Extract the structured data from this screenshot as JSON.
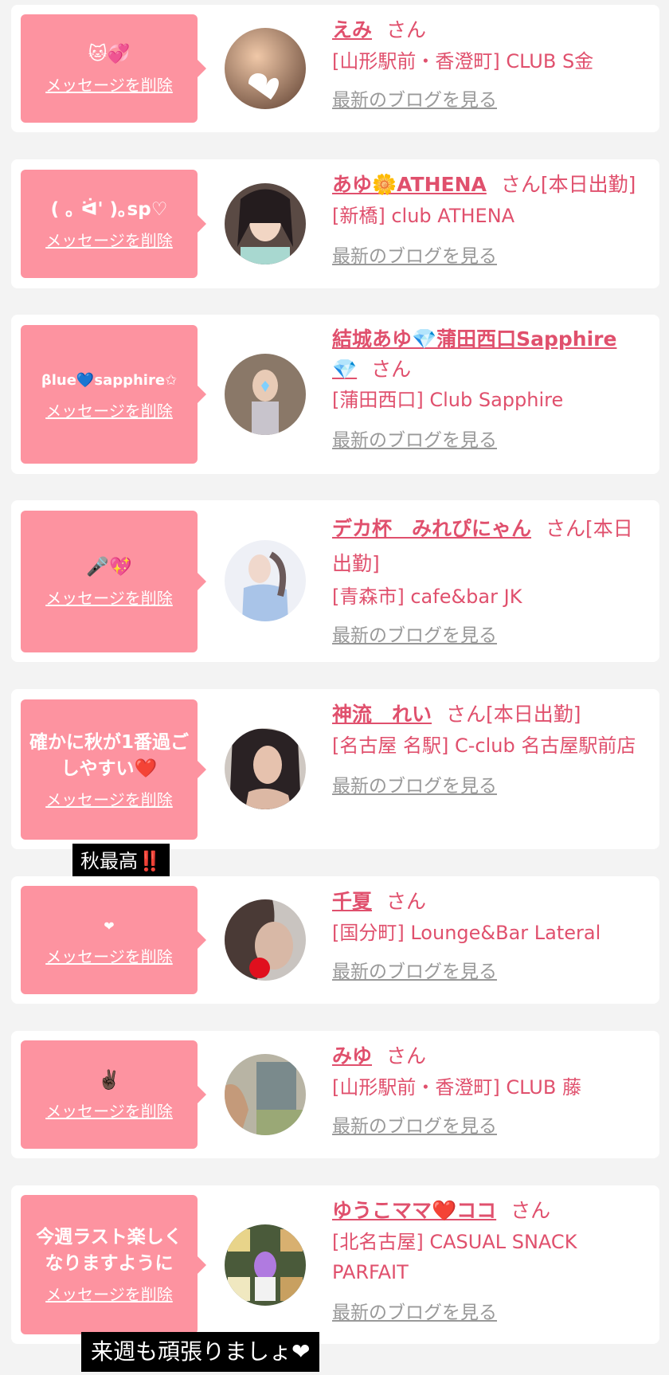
{
  "delete_label": "メッセージを削除",
  "honorific": "さん",
  "blog_label": "最新のブログを見る",
  "colors": {
    "accent": "#e0506d",
    "bubble": "#fd93a0",
    "link_gray": "#999999"
  },
  "messages": [
    {
      "bubble_text": "🐱💞",
      "name": "えみ",
      "suffix": "",
      "shop": "[山形駅前・香澄町] CLUB S金"
    },
    {
      "bubble_text": "( ｡ ᐛ' )｡sp♡",
      "name": "あゆ🌼ATHENA",
      "suffix": "[本日出勤]",
      "shop": "[新橋] club ATHENA"
    },
    {
      "bubble_text": "βlue💙sapphire✩",
      "name": "結城あゆ💎蒲田西口Sapphire 💎",
      "suffix": "",
      "shop": "[蒲田西口] Club Sapphire"
    },
    {
      "bubble_text": "🎤💖",
      "name": "デカ杯　みれぴにゃん",
      "suffix": "[本日出勤]",
      "shop": "[青森市] cafe&bar JK"
    },
    {
      "bubble_text": "確かに秋が1番過ごしやすい❤️",
      "name": "神流　れい",
      "suffix": "[本日出勤]",
      "shop": "[名古屋 名駅] C-club 名古屋駅前店"
    },
    {
      "bubble_text": "❤",
      "name": "千夏",
      "suffix": "",
      "shop": "[国分町] Lounge&Bar Lateral"
    },
    {
      "bubble_text": "✌🏿",
      "name": "みゆ",
      "suffix": "",
      "shop": "[山形駅前・香澄町] CLUB 藤"
    },
    {
      "bubble_text": "今週ラスト楽しくなりますように",
      "name": "ゆうこママ❤️ココ",
      "suffix": "",
      "shop": "[北名古屋] CASUAL SNACK PARFAIT"
    }
  ],
  "captions": [
    "秋最高‼️",
    "来週も頑張りましょ❤"
  ]
}
